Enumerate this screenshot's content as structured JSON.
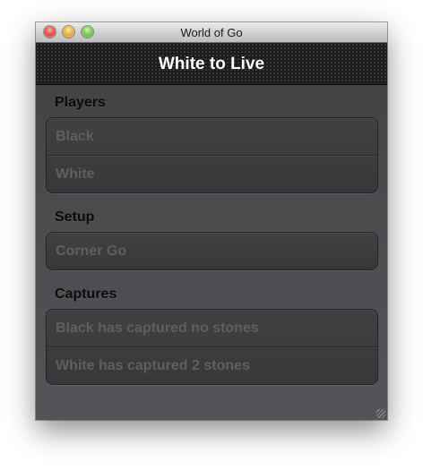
{
  "window": {
    "title": "World of Go"
  },
  "navbar": {
    "title": "White to Live"
  },
  "sections": {
    "players": {
      "header": "Players",
      "items": [
        {
          "label": "Black"
        },
        {
          "label": "White"
        }
      ]
    },
    "setup": {
      "header": "Setup",
      "items": [
        {
          "label": "Corner Go"
        }
      ]
    },
    "captures": {
      "header": "Captures",
      "items": [
        {
          "label": "Black has captured no stones"
        },
        {
          "label": "White has captured 2 stones"
        }
      ]
    }
  },
  "colors": {
    "navbar_bg": "#1b1b1c",
    "content_bg": "#4a4a4d",
    "cell_text": "#5f5f62",
    "header_text": "#0b0b0b"
  }
}
